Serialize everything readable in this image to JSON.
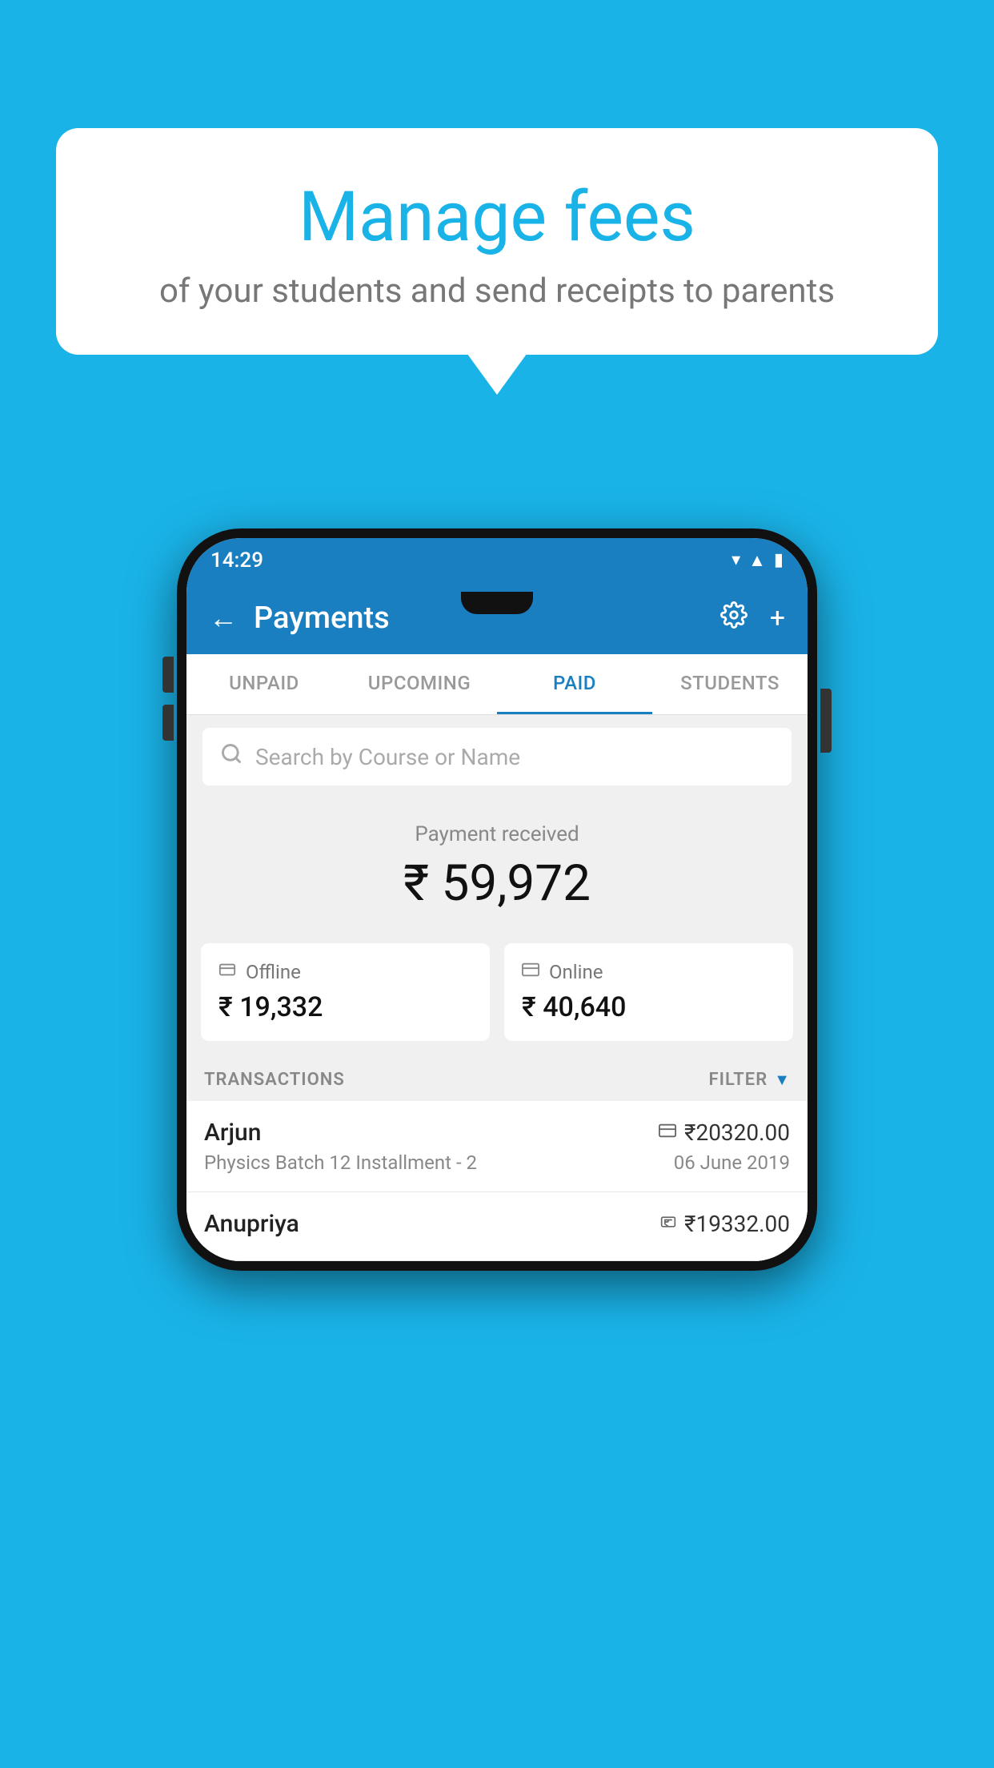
{
  "background_color": "#1ab3e8",
  "speech_bubble": {
    "title": "Manage fees",
    "subtitle": "of your students and send receipts to parents"
  },
  "phone": {
    "status_bar": {
      "time": "14:29",
      "icons": [
        "wifi",
        "signal",
        "battery"
      ]
    },
    "app_bar": {
      "title": "Payments",
      "back_label": "←",
      "settings_label": "⚙",
      "add_label": "+"
    },
    "tabs": [
      {
        "label": "UNPAID",
        "active": false
      },
      {
        "label": "UPCOMING",
        "active": false
      },
      {
        "label": "PAID",
        "active": true
      },
      {
        "label": "STUDENTS",
        "active": false
      }
    ],
    "search": {
      "placeholder": "Search by Course or Name"
    },
    "payment_received": {
      "label": "Payment received",
      "amount": "₹ 59,972"
    },
    "payment_cards": [
      {
        "type": "Offline",
        "amount": "₹ 19,332"
      },
      {
        "type": "Online",
        "amount": "₹ 40,640"
      }
    ],
    "transactions": {
      "label": "TRANSACTIONS",
      "filter_label": "FILTER"
    },
    "transaction_rows": [
      {
        "name": "Arjun",
        "amount": "₹20320.00",
        "payment_type": "card",
        "description": "Physics Batch 12 Installment - 2",
        "date": "06 June 2019"
      },
      {
        "name": "Anupriya",
        "amount": "₹19332.00",
        "payment_type": "rupee",
        "description": "",
        "date": ""
      }
    ]
  }
}
